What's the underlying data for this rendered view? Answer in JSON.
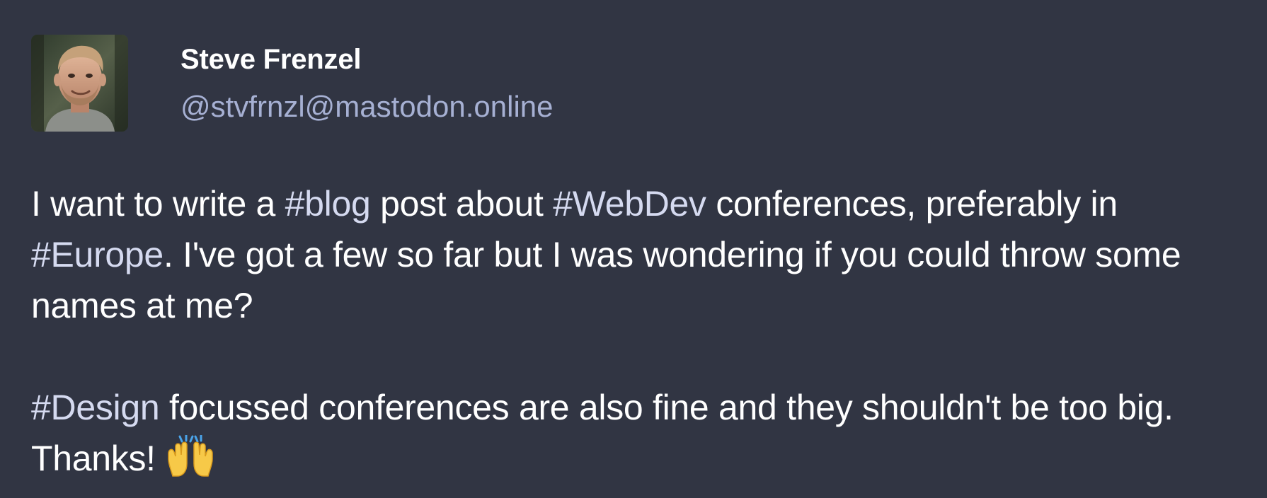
{
  "author": {
    "display_name": "Steve Frenzel",
    "account": "@stvfrnzl@mastodon.online",
    "avatar_icon": "user-avatar-photo"
  },
  "post": {
    "paragraph1": {
      "t1": "I want to write a ",
      "tag1": "#blog",
      "t2": " post about ",
      "tag2": "#WebDev",
      "t3": " conferences, preferably in ",
      "tag3": "#Europe",
      "t4": ". I've got a few so far but I was wondering if you could throw some names at me?"
    },
    "paragraph2": {
      "tag1": "#Design",
      "t1": " focussed conferences are also fine and they shouldn't be too big. Thanks!",
      "emoji": "raising-hands-emoji"
    }
  },
  "colors": {
    "background": "#313543",
    "text": "#ffffff",
    "account": "#a6b0d3",
    "hashtag": "#d5daf0"
  }
}
